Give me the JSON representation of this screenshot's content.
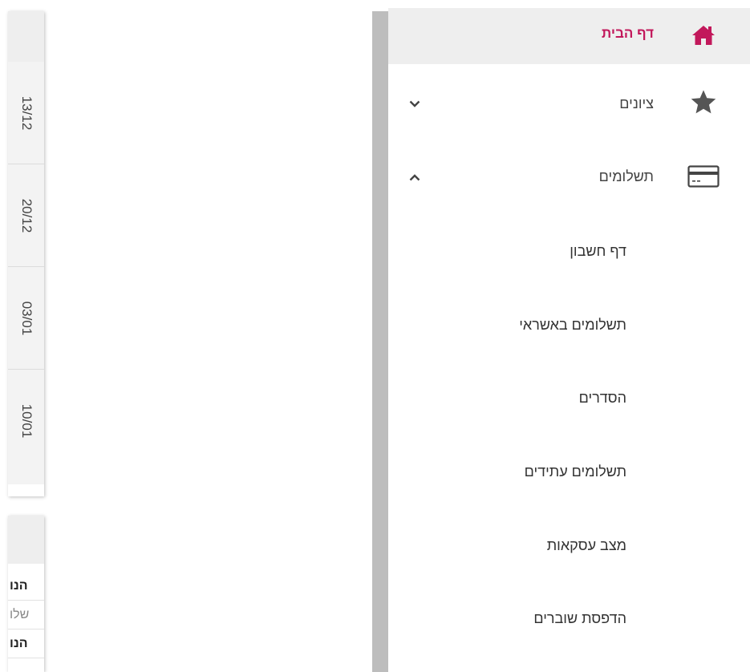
{
  "sidebar": {
    "home": {
      "label": "דף הבית",
      "icon": "home-icon",
      "color": "#c2185b"
    },
    "grades": {
      "label": "ציונים",
      "icon": "star-icon",
      "chevron": "chevron-down-icon"
    },
    "payments": {
      "label": "תשלומים",
      "icon": "credit-card-icon",
      "chevron": "chevron-up-icon",
      "items": [
        {
          "label": "דף חשבון"
        },
        {
          "label": "תשלומים באשראי"
        },
        {
          "label": "הסדרים"
        },
        {
          "label": "תשלומים עתידים"
        },
        {
          "label": "מצב עסקאות"
        },
        {
          "label": "הדפסת שוברים"
        }
      ]
    }
  },
  "background": {
    "dates": [
      "13/12",
      "20/12",
      "03/01",
      "10/01"
    ],
    "rows": [
      {
        "text": "הנו",
        "style": "bold"
      },
      {
        "text": "שלו",
        "style": "light"
      },
      {
        "text": "הנו",
        "style": "bold"
      }
    ]
  }
}
